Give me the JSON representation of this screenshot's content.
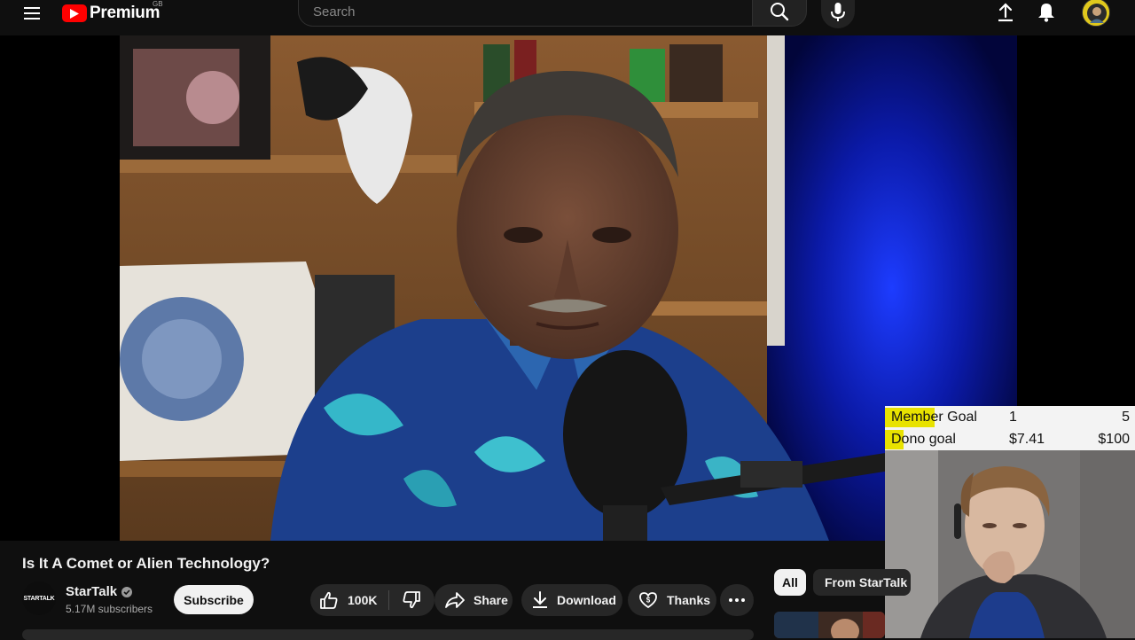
{
  "header": {
    "brand": "Premium",
    "region": "GB",
    "search_placeholder": "Search"
  },
  "video": {
    "title": "Is It A Comet or Alien Technology?"
  },
  "channel": {
    "avatar_text": "STARTALK",
    "name": "StarTalk",
    "subscribers": "5.17M subscribers",
    "subscribe_label": "Subscribe"
  },
  "actions": {
    "likes": "100K",
    "share": "Share",
    "download": "Download",
    "thanks": "Thanks"
  },
  "chips": {
    "all": "All",
    "from": "From StarTalk"
  },
  "overlay": {
    "member_goal": {
      "label": "Member Goal",
      "current": "1",
      "target": "5",
      "progress": 0.2
    },
    "dono_goal": {
      "label": "Dono goal",
      "current": "$7.41",
      "target": "$100",
      "progress": 0.0741
    }
  },
  "colors": {
    "background": "#0f0f0f",
    "brand_red": "#ff0000",
    "pill_bg": "#272727",
    "goal_highlight": "#e8e200"
  },
  "icons": [
    "menu-icon",
    "youtube-play-icon",
    "search-icon",
    "microphone-icon",
    "upload-icon",
    "bell-icon",
    "verified-icon",
    "thumbs-up-icon",
    "thumbs-down-icon",
    "share-arrow-icon",
    "download-icon",
    "thanks-heart-icon",
    "more-horizontal-icon"
  ]
}
